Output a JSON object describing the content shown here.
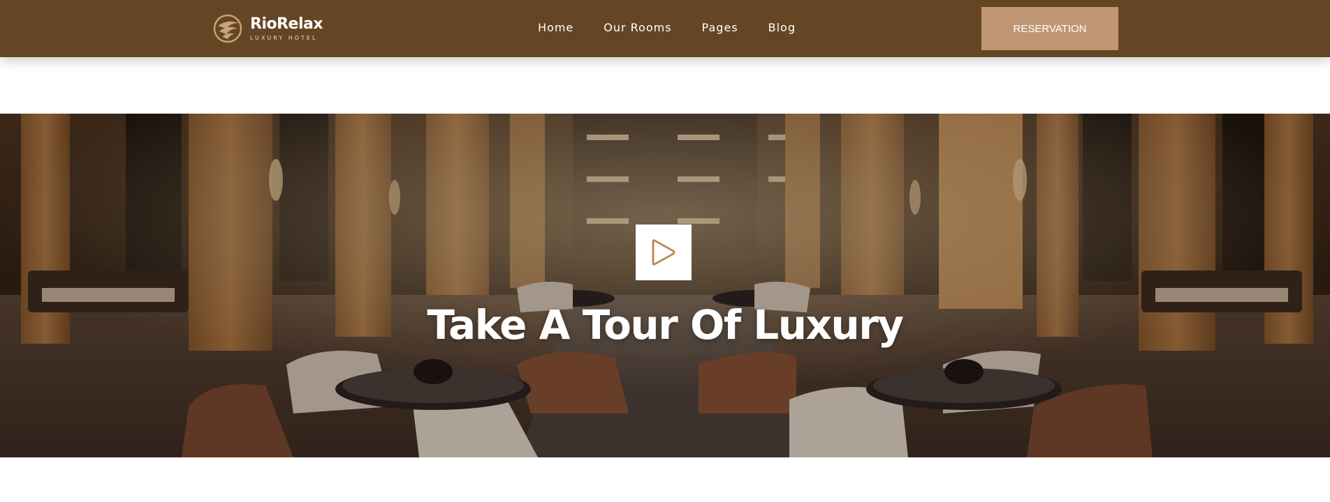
{
  "header": {
    "logo": {
      "name": "RioRelax",
      "tagline": "LUXURY HOTEL"
    },
    "nav": [
      {
        "label": "Home"
      },
      {
        "label": "Our Rooms"
      },
      {
        "label": "Pages"
      },
      {
        "label": "Blog"
      }
    ],
    "reservation_label": "RESERVATION"
  },
  "hero": {
    "title": "Take A Tour Of Luxury",
    "play_icon": "play-icon"
  },
  "colors": {
    "header_bg": "#644524",
    "button_bg": "#bf9774",
    "play_accent": "#c08a55",
    "text": "#ffffff"
  }
}
